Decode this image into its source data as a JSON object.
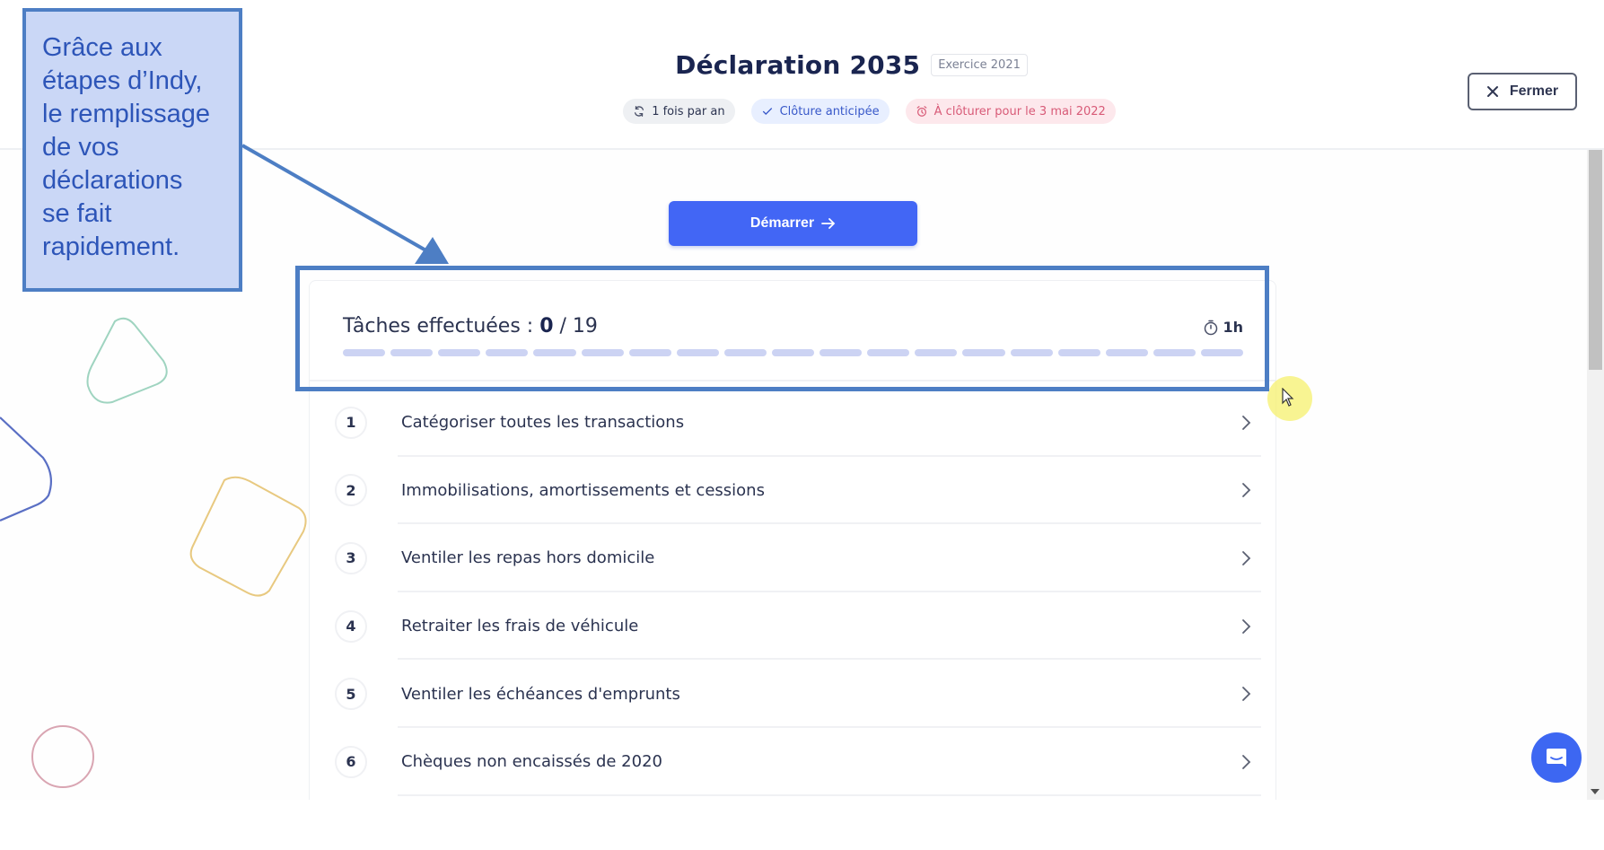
{
  "header": {
    "title": "Déclaration 2035",
    "exercise_badge": "Exercice 2021",
    "chips": [
      {
        "icon": "refresh-icon",
        "label": "1 fois par an",
        "tone": "grey"
      },
      {
        "icon": "check-icon",
        "label": "Clôture anticipée",
        "tone": "blue"
      },
      {
        "icon": "alarm-clock-icon",
        "label": "À clôturer pour le 3 mai 2022",
        "tone": "red"
      }
    ],
    "close_label": "Fermer"
  },
  "start_button": {
    "label": "Démarrer",
    "icon": "arrow-right-icon"
  },
  "tasks": {
    "label_prefix": "Tâches effectuées : ",
    "done": 0,
    "total": 19,
    "progress_text": "0 / 19",
    "duration": "1h",
    "items": [
      {
        "number": "1",
        "label": "Catégoriser toutes les transactions"
      },
      {
        "number": "2",
        "label": "Immobilisations, amortissements et cessions"
      },
      {
        "number": "3",
        "label": "Ventiler les repas hors domicile"
      },
      {
        "number": "4",
        "label": "Retraiter les frais de véhicule"
      },
      {
        "number": "5",
        "label": "Ventiler les échéances d'emprunts"
      },
      {
        "number": "6",
        "label": "Chèques non encaissés de 2020"
      }
    ]
  },
  "annotation": {
    "text": "Grâce aux\nétapes d’Indy,\nle remplissage\nde vos\ndéclarations\nse fait\nrapidement."
  },
  "colors": {
    "accent": "#4266f5",
    "annotation_border": "#4d7ec4",
    "annotation_fill": "#cad7f6",
    "progress_empty": "#ccd3f3"
  }
}
